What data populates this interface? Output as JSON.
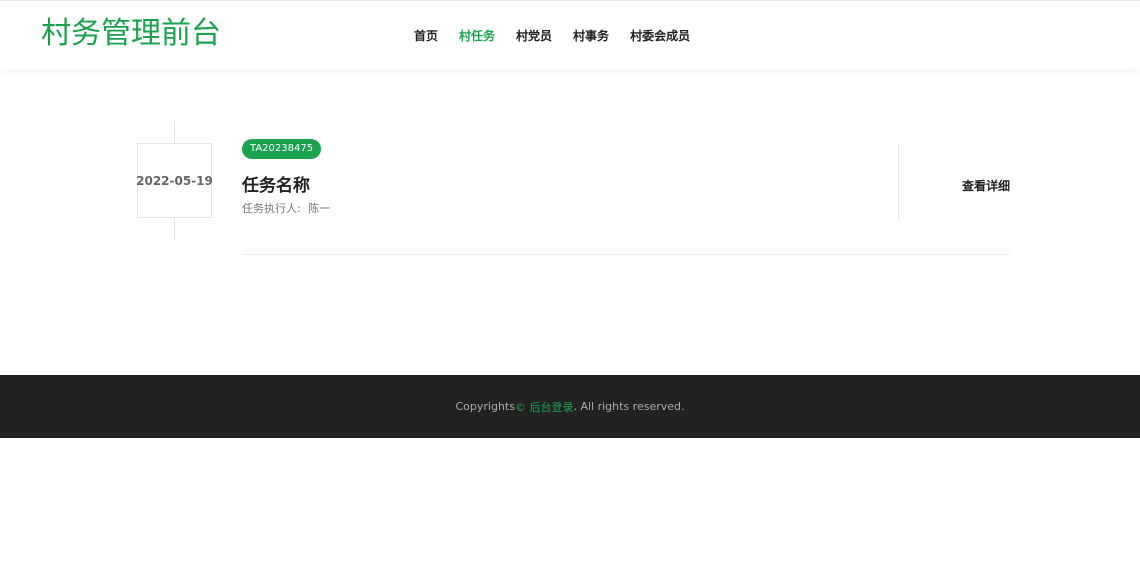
{
  "header": {
    "logo": "村务管理前台",
    "nav": [
      {
        "label": "首页",
        "active": false
      },
      {
        "label": "村任务",
        "active": true
      },
      {
        "label": "村党员",
        "active": false
      },
      {
        "label": "村事务",
        "active": false
      },
      {
        "label": "村委会成员",
        "active": false
      }
    ]
  },
  "task": {
    "date": "2022-05-19",
    "code": "TA20238475",
    "title": "任务名称",
    "executor_label": "任务执行人:",
    "executor": "陈一",
    "details_label": "查看详细"
  },
  "footer": {
    "prefix": "Copyrights ",
    "link": "© 后台登录",
    "suffix": ". All rights reserved."
  },
  "colors": {
    "accent": "#1aa24e",
    "footer_bg": "#222222",
    "text": "#222222"
  }
}
